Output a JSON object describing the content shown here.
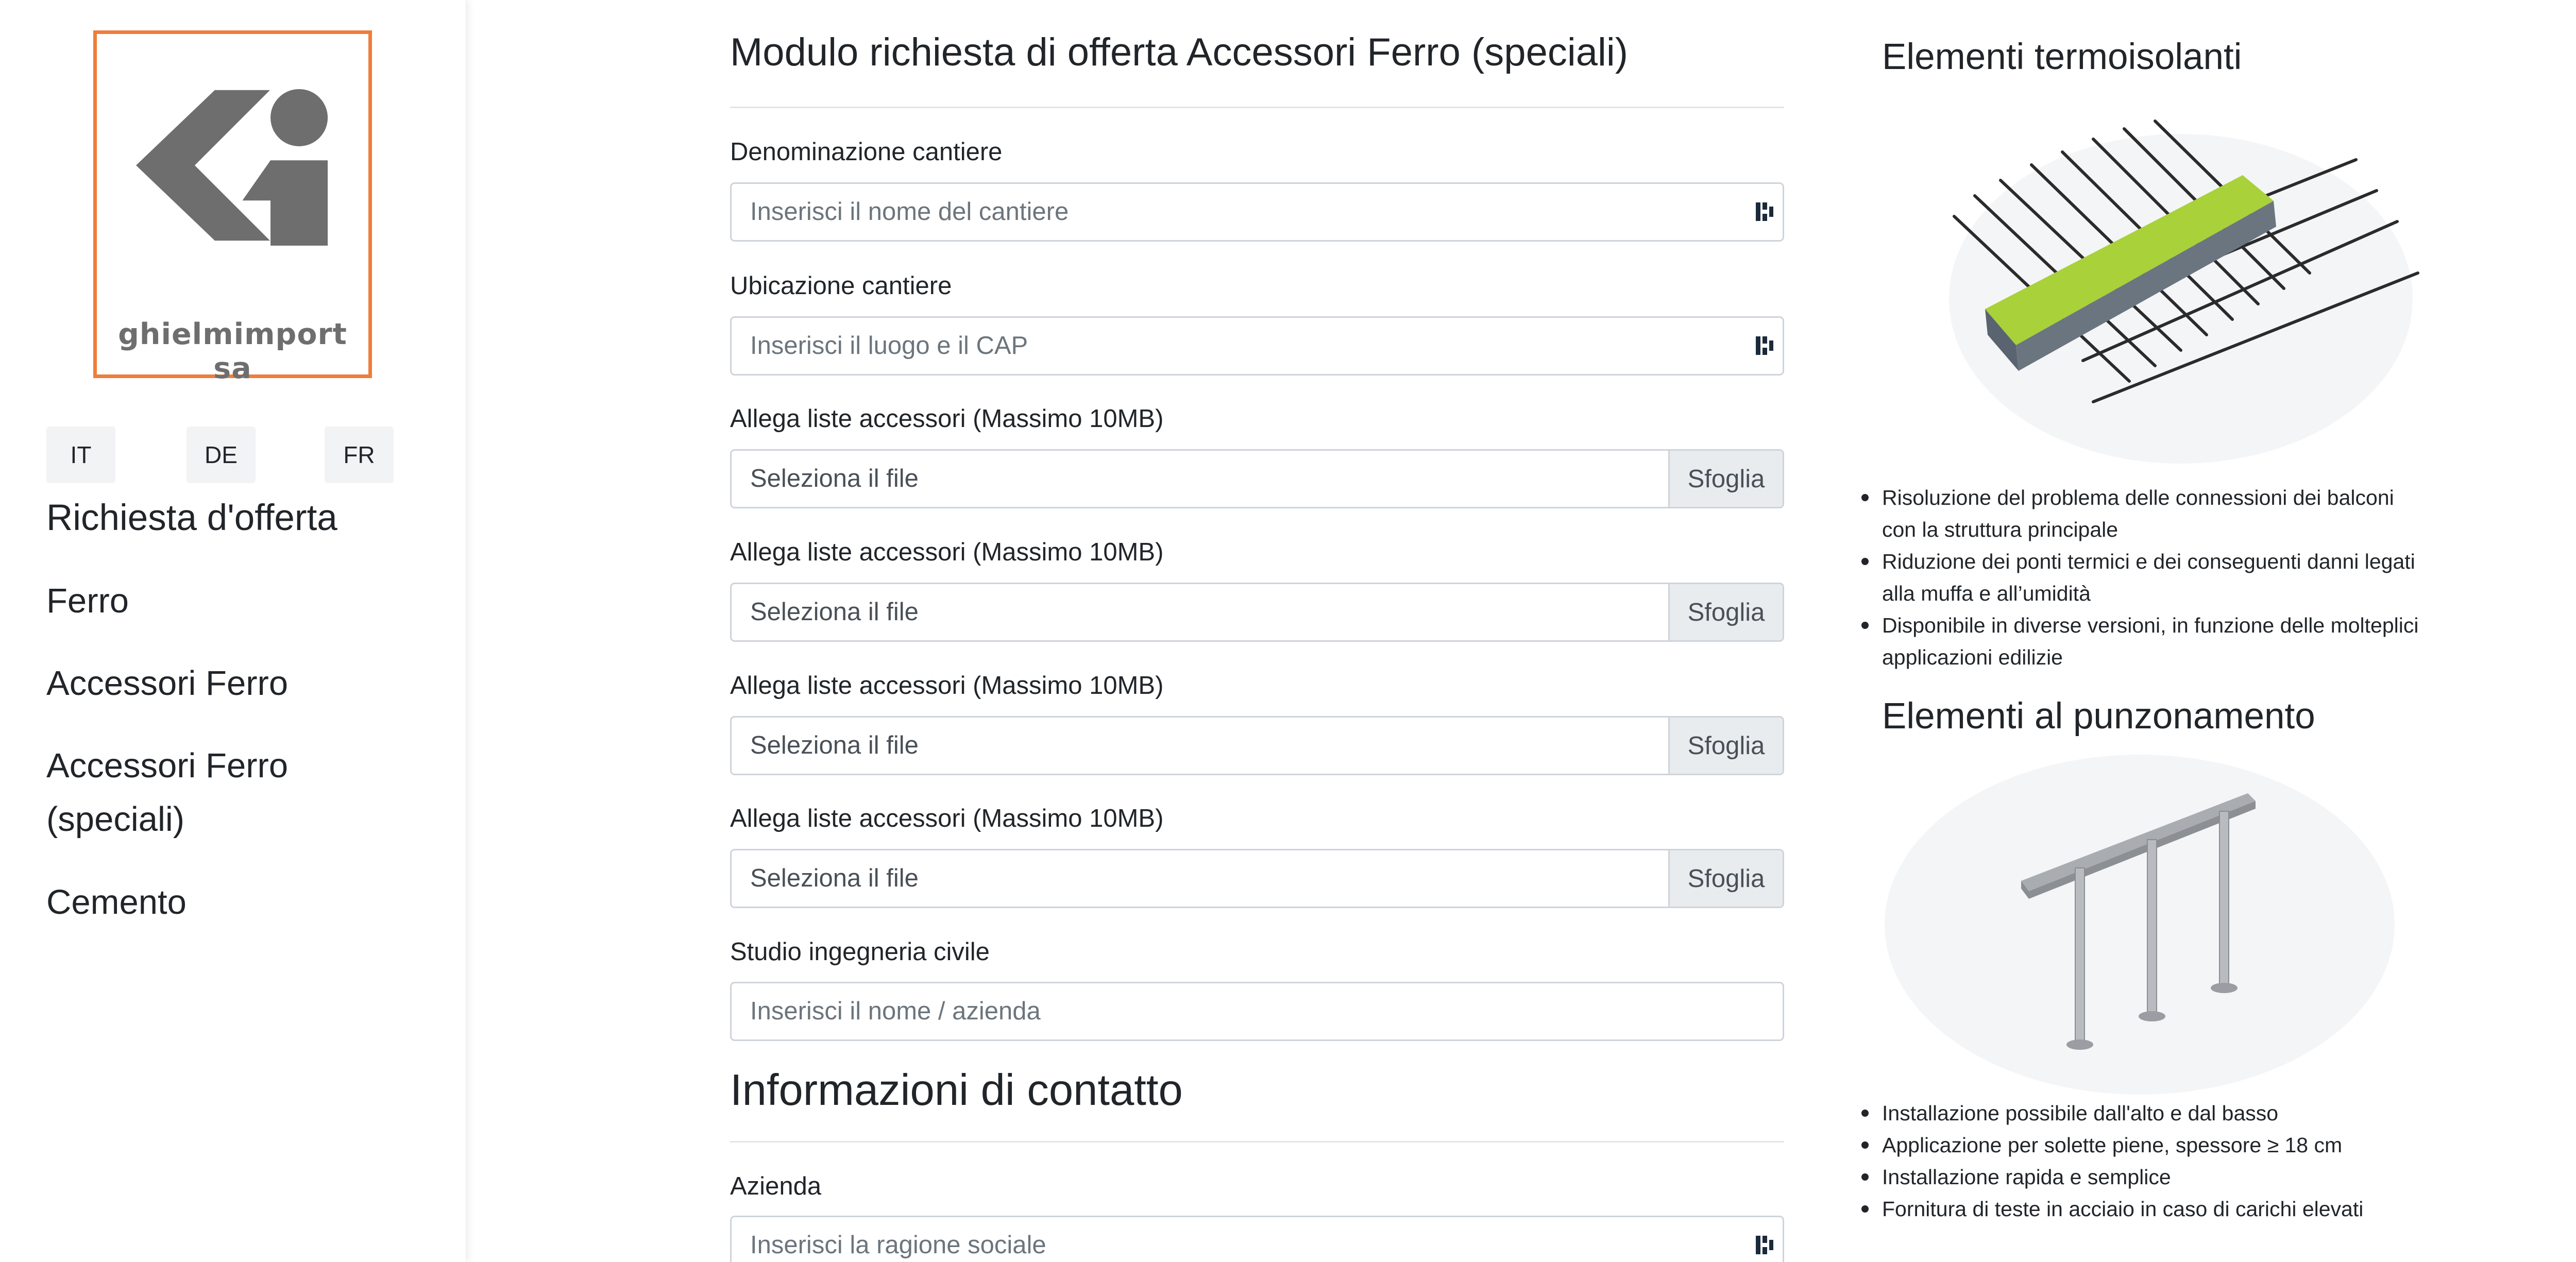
{
  "logo": {
    "company": "ghielmimport sa",
    "accent_color": "#ee7d3b"
  },
  "languages": [
    "IT",
    "DE",
    "FR"
  ],
  "sidebar": {
    "heading": "Richiesta d'offerta",
    "items": [
      {
        "label": "Ferro"
      },
      {
        "label": "Accessori Ferro"
      },
      {
        "label": "Accessori Ferro\n(speciali)"
      },
      {
        "label": "Cemento"
      }
    ]
  },
  "form": {
    "title": "Modulo richiesta di offerta Accessori Ferro (speciali)",
    "site_name": {
      "label": "Denominazione cantiere",
      "placeholder": "Inserisci il nome del cantiere"
    },
    "site_location": {
      "label": "Ubicazione cantiere",
      "placeholder": "Inserisci il luogo e il CAP"
    },
    "attachments": [
      {
        "label": "Allega liste accessori (Massimo 10MB)",
        "placeholder": "Seleziona il file",
        "button": "Sfoglia"
      },
      {
        "label": "Allega liste accessori (Massimo 10MB)",
        "placeholder": "Seleziona il file",
        "button": "Sfoglia"
      },
      {
        "label": "Allega liste accessori (Massimo 10MB)",
        "placeholder": "Seleziona il file",
        "button": "Sfoglia"
      },
      {
        "label": "Allega liste accessori (Massimo 10MB)",
        "placeholder": "Seleziona il file",
        "button": "Sfoglia"
      }
    ],
    "engineering": {
      "label": "Studio ingegneria civile",
      "placeholder": "Inserisci il nome / azienda"
    },
    "contact_title": "Informazioni di contatto",
    "company": {
      "label": "Azienda",
      "placeholder": "Inserisci la ragione sociale"
    }
  },
  "products": [
    {
      "title": "Elementi termoisolanti",
      "bullets": [
        "Risoluzione del problema delle connessioni dei balconi con la struttura principale",
        "Riduzione dei ponti termici e dei conseguenti danni legati alla muffa e all’umidità",
        "Disponibile in diverse versioni, in funzione delle molteplici applicazioni edilizie"
      ]
    },
    {
      "title": "Elementi al punzonamento",
      "bullets": [
        "Installazione possibile dall'alto e dal basso",
        "Applicazione per solette piene, spessore ≥ 18 cm",
        "Installazione rapida e semplice",
        "Fornitura di teste in acciaio in caso di carichi elevati"
      ]
    }
  ]
}
